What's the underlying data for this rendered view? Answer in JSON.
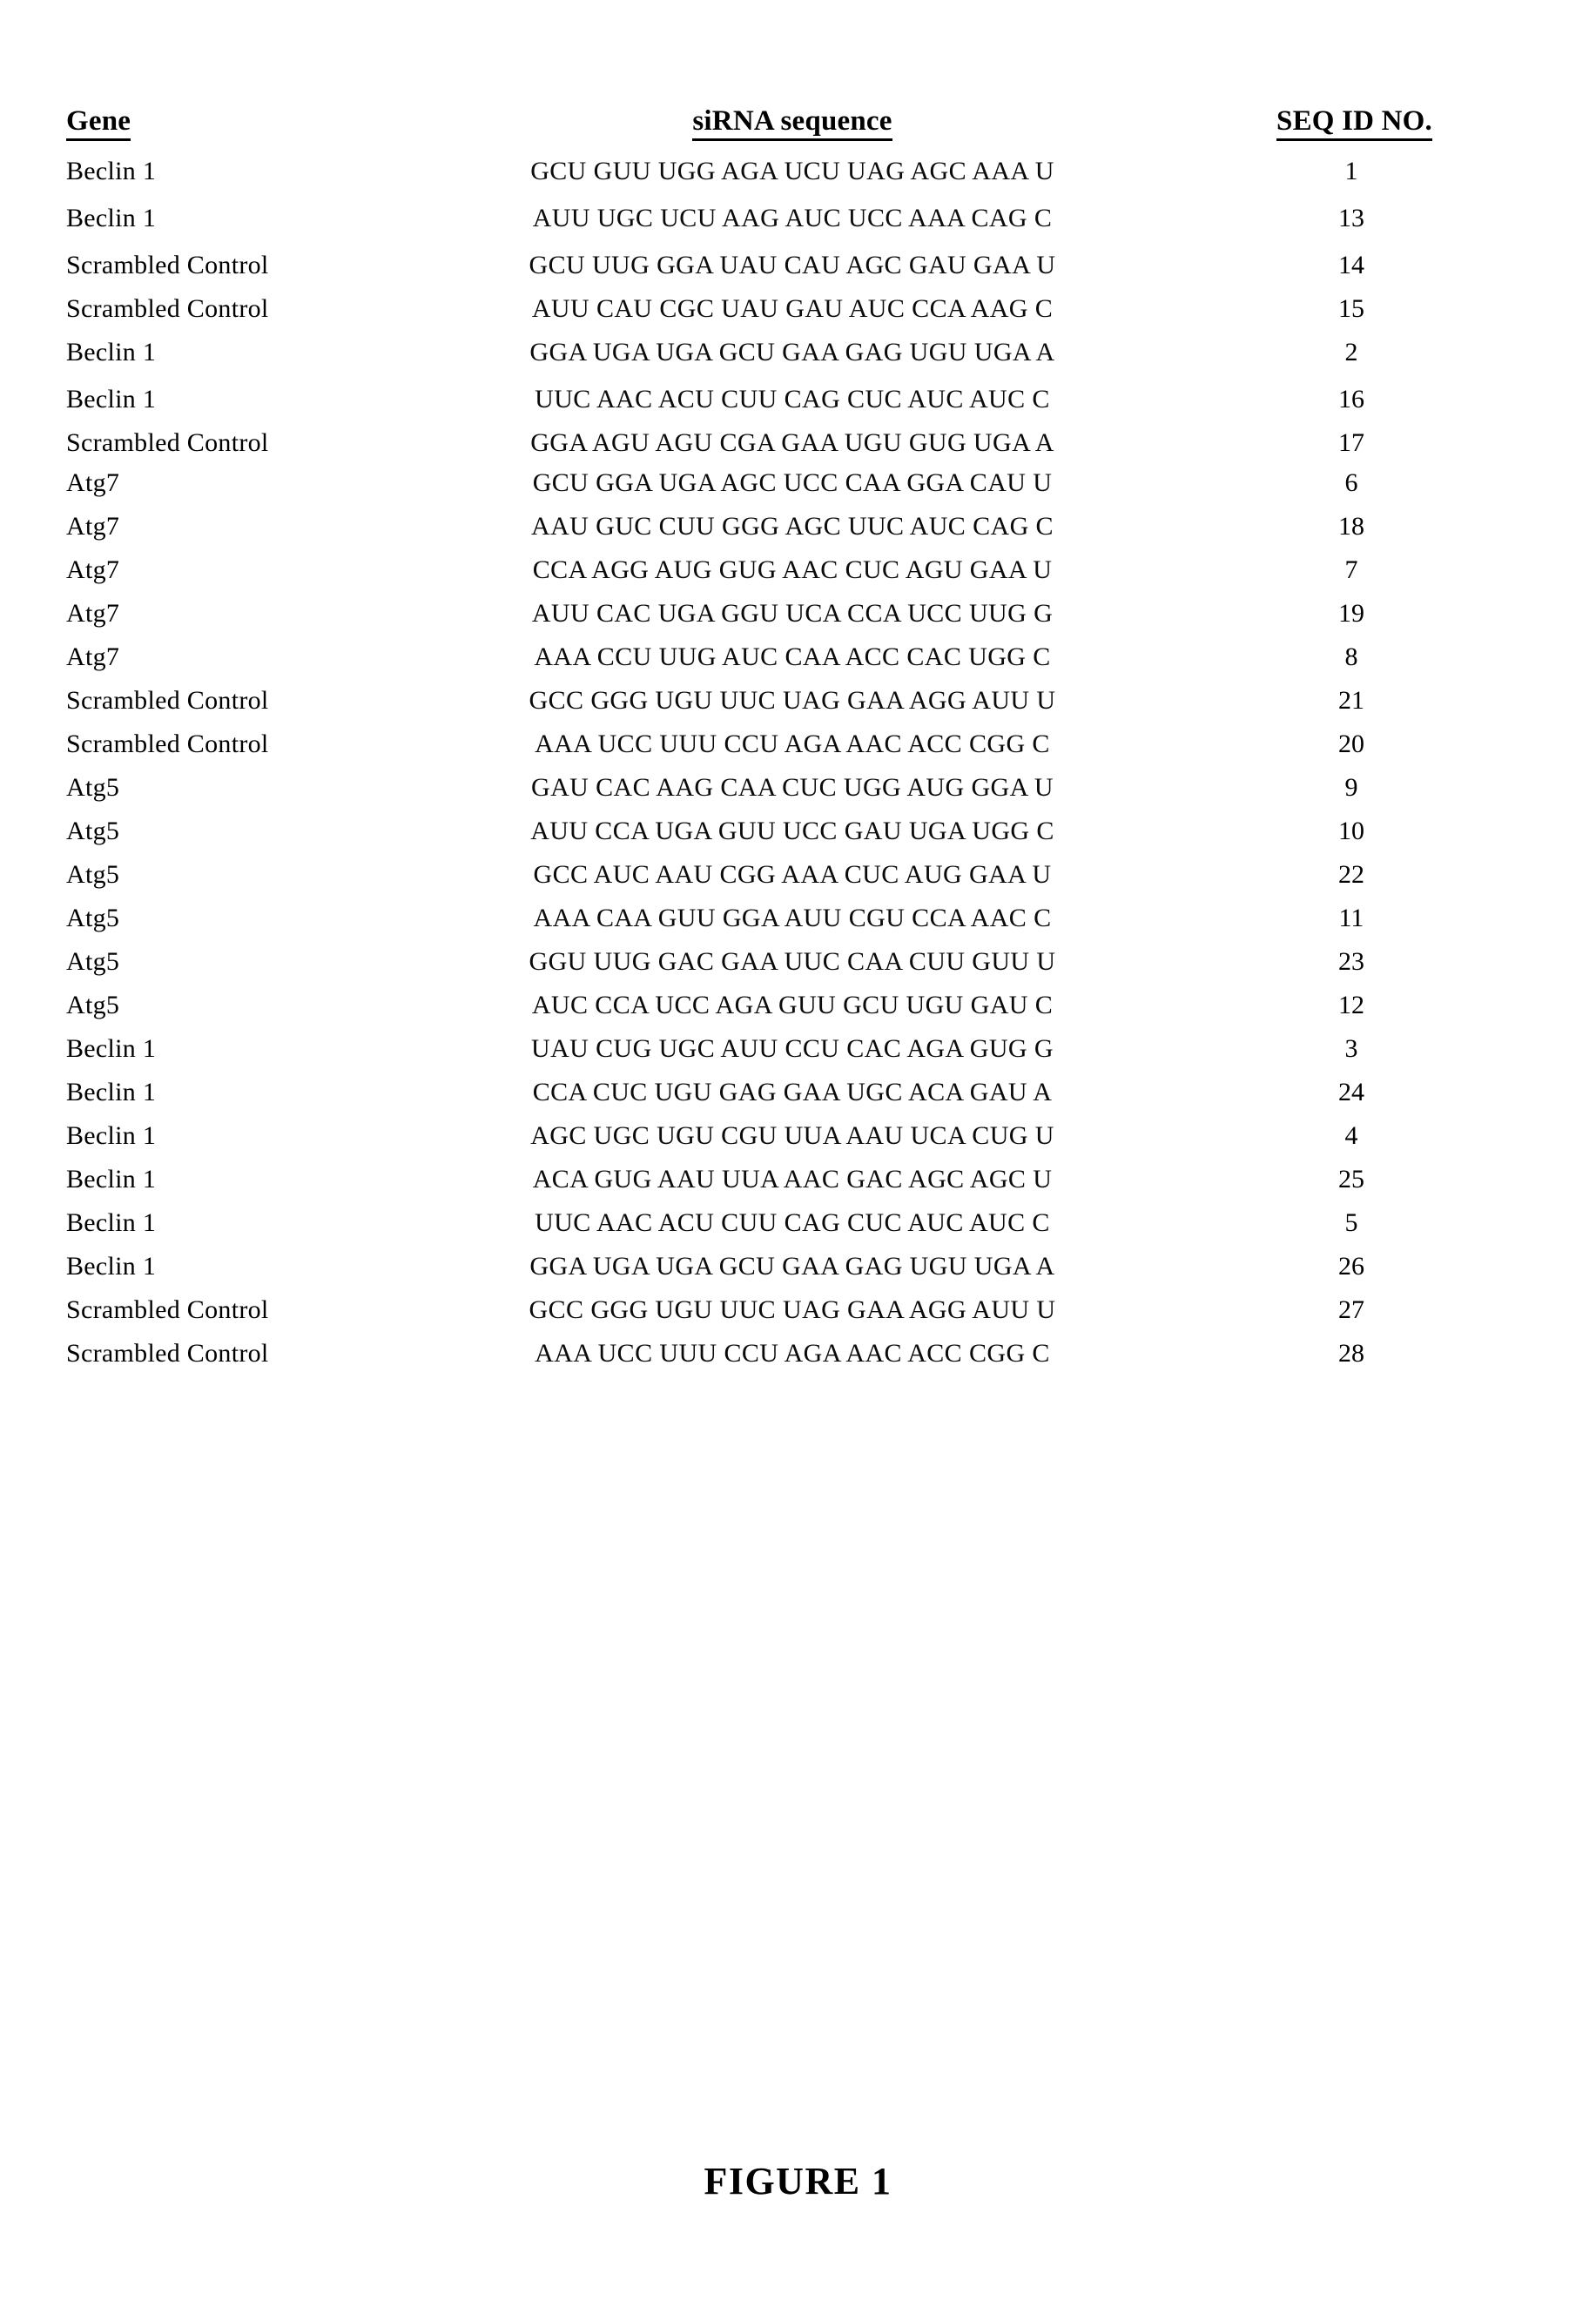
{
  "table": {
    "headers": {
      "gene": "Gene",
      "sequence": "siRNA sequence",
      "seq_id": "SEQ ID NO."
    },
    "rows": [
      {
        "gene": "Beclin 1",
        "sequence": "GCU GUU UGG AGA UCU UAG AGC AAA U",
        "seq_id": "1"
      },
      {
        "gene": "Beclin 1",
        "sequence": "AUU UGC UCU AAG AUC UCC AAA CAG C",
        "seq_id": "13"
      },
      {
        "gene": "Scrambled Control",
        "sequence": "GCU UUG GGA UAU CAU AGC GAU GAA U",
        "seq_id": "14"
      },
      {
        "gene": "Scrambled Control",
        "sequence": "AUU CAU CGC UAU GAU AUC CCA AAG C",
        "seq_id": "15"
      },
      {
        "gene": "Beclin 1",
        "sequence": "GGA UGA UGA GCU GAA GAG UGU UGA A",
        "seq_id": "2"
      },
      {
        "gene": "Beclin 1",
        "sequence": "UUC AAC ACU CUU CAG CUC AUC AUC C",
        "seq_id": "16"
      },
      {
        "gene": "Scrambled Control",
        "sequence": "GGA AGU AGU CGA GAA UGU GUG UGA A",
        "seq_id": "17"
      },
      {
        "gene": "Atg7",
        "sequence": "GCU GGA UGA AGC UCC CAA GGA CAU U",
        "seq_id": "6"
      },
      {
        "gene": "Atg7",
        "sequence": "AAU GUC CUU GGG AGC UUC AUC CAG C",
        "seq_id": "18"
      },
      {
        "gene": "Atg7",
        "sequence": "CCA AGG AUG GUG AAC CUC AGU GAA U",
        "seq_id": "7"
      },
      {
        "gene": "Atg7",
        "sequence": "AUU CAC UGA GGU UCA CCA UCC UUG G",
        "seq_id": "19"
      },
      {
        "gene": "Atg7",
        "sequence": "AAA CCU UUG AUC CAA ACC CAC UGG C",
        "seq_id": "8"
      },
      {
        "gene": "Scrambled Control",
        "sequence": "GCC GGG UGU UUC UAG GAA AGG AUU U",
        "seq_id": "21"
      },
      {
        "gene": "Scrambled Control",
        "sequence": "AAA UCC UUU CCU AGA AAC ACC CGG C",
        "seq_id": "20"
      },
      {
        "gene": "Atg5",
        "sequence": "GAU CAC AAG CAA CUC UGG AUG GGA U",
        "seq_id": "9"
      },
      {
        "gene": "Atg5",
        "sequence": "AUU CCA UGA GUU UCC GAU UGA UGG C",
        "seq_id": "10"
      },
      {
        "gene": "Atg5",
        "sequence": "GCC AUC AAU CGG AAA CUC AUG GAA U",
        "seq_id": "22"
      },
      {
        "gene": "Atg5",
        "sequence": "AAA CAA GUU GGA AUU CGU CCA AAC C",
        "seq_id": "11"
      },
      {
        "gene": "Atg5",
        "sequence": "GGU UUG GAC GAA UUC CAA CUU GUU U",
        "seq_id": "23"
      },
      {
        "gene": "Atg5",
        "sequence": "AUC CCA UCC AGA GUU GCU UGU GAU C",
        "seq_id": "12"
      },
      {
        "gene": "Beclin 1",
        "sequence": "UAU CUG UGC AUU CCU CAC AGA GUG G",
        "seq_id": "3"
      },
      {
        "gene": "Beclin 1",
        "sequence": "CCA CUC UGU GAG GAA UGC ACA GAU A",
        "seq_id": "24"
      },
      {
        "gene": "Beclin 1",
        "sequence": "AGC UGC UGU CGU UUA AAU UCA CUG U",
        "seq_id": "4"
      },
      {
        "gene": "Beclin 1",
        "sequence": "ACA GUG AAU UUA AAC GAC AGC AGC U",
        "seq_id": "25"
      },
      {
        "gene": "Beclin 1",
        "sequence": "UUC AAC ACU CUU CAG CUC AUC AUC C",
        "seq_id": "5"
      },
      {
        "gene": "Beclin 1",
        "sequence": "GGA UGA UGA GCU GAA GAG UGU UGA A",
        "seq_id": "26"
      },
      {
        "gene": "Scrambled Control",
        "sequence": "GCC GGG UGU UUC UAG GAA AGG AUU U",
        "seq_id": "27"
      },
      {
        "gene": "Scrambled Control",
        "sequence": "AAA UCC UUU CCU AGA AAC ACC CGG C",
        "seq_id": "28"
      }
    ]
  },
  "figure": {
    "caption": "FIGURE 1"
  }
}
